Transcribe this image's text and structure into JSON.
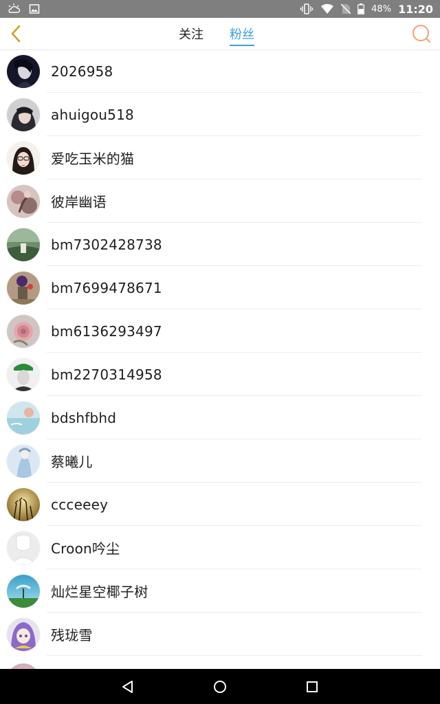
{
  "status_bar": {
    "battery_percent": "48%",
    "time": "11:20",
    "icons": [
      "weather-icon",
      "image-notification-icon",
      "vibrate-icon",
      "wifi-icon",
      "no-sim-icon",
      "battery-icon"
    ]
  },
  "header": {
    "tabs": [
      {
        "label": "关注",
        "active": false
      },
      {
        "label": "粉丝",
        "active": true
      }
    ],
    "accent_color": "#3b9ee0",
    "back_color": "#c9a227",
    "search_color": "#f0a070"
  },
  "fans": [
    {
      "name": "2026958",
      "avatar": "dark-portrait"
    },
    {
      "name": "ahuigou518",
      "avatar": "girl-portrait"
    },
    {
      "name": "爱吃玉米的猫",
      "avatar": "cartoon-glasses"
    },
    {
      "name": "彼岸幽语",
      "avatar": "pastel-art"
    },
    {
      "name": "bm7302428738",
      "avatar": "green-scene"
    },
    {
      "name": "bm7699478671",
      "avatar": "figure-balloon"
    },
    {
      "name": "bm6136293497",
      "avatar": "rose"
    },
    {
      "name": "bm2270314958",
      "avatar": "bw-cap"
    },
    {
      "name": "bdshfbhd",
      "avatar": "sea-watercolor"
    },
    {
      "name": "蔡曦儿",
      "avatar": "blue-anime"
    },
    {
      "name": "ccceeey",
      "avatar": "sunset-grass"
    },
    {
      "name": "Croon吟尘",
      "avatar": "default-silhouette"
    },
    {
      "name": "灿烂星空椰子树",
      "avatar": "sky-tree"
    },
    {
      "name": "残珑雪",
      "avatar": "anime-purple"
    }
  ]
}
